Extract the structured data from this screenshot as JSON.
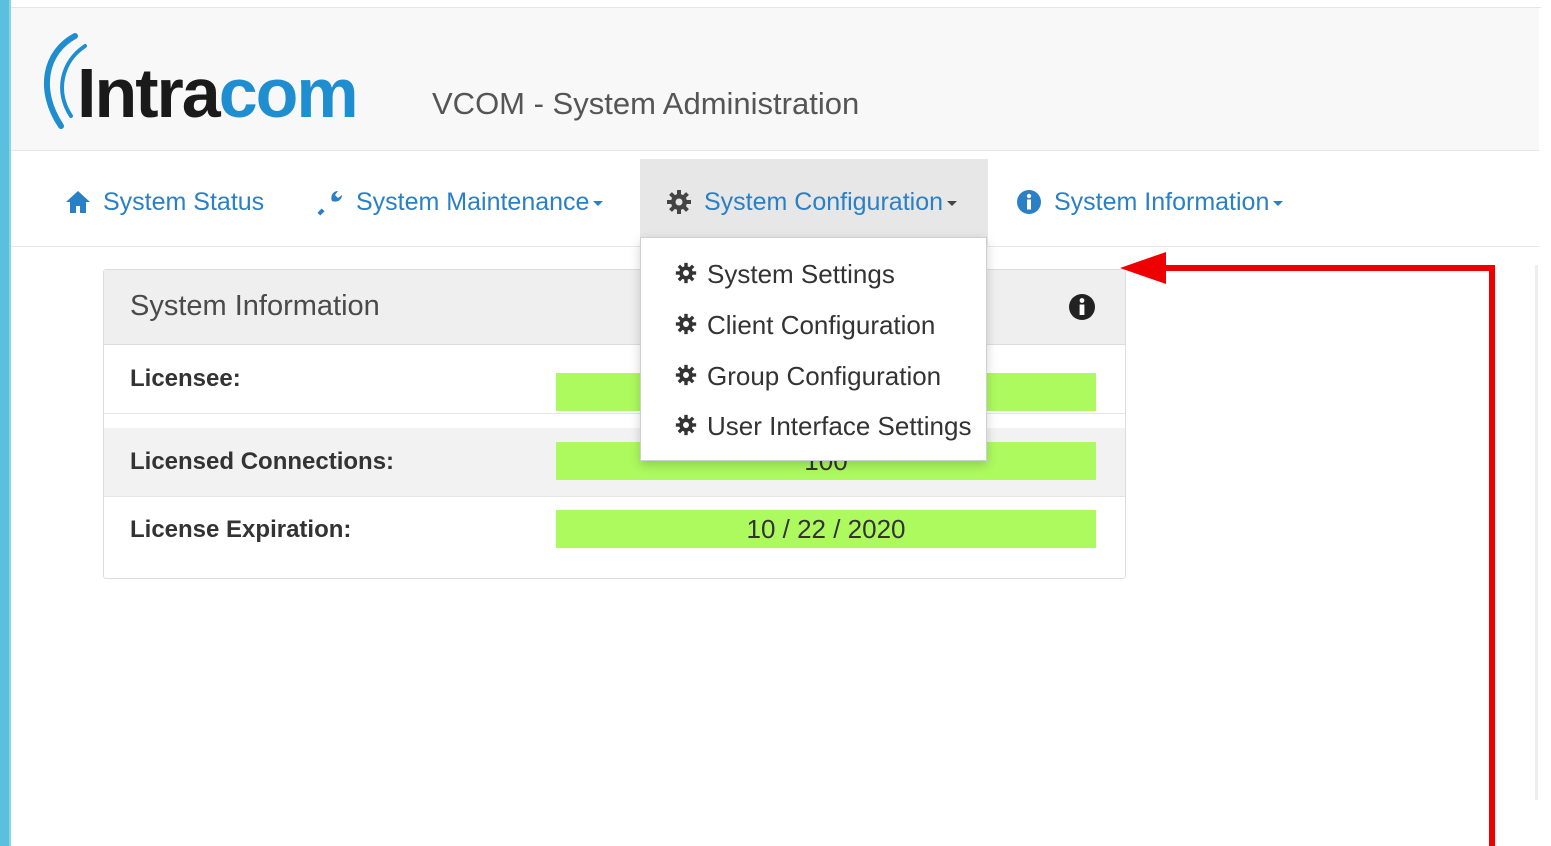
{
  "brand": {
    "logo_text_dark": "Intra",
    "logo_text_blue": "com",
    "app_title": "VCOM - System Administration",
    "accent_color": "#5bc0de",
    "logo_blue": "#1f8ed0"
  },
  "nav": {
    "items": [
      {
        "label": "System Status",
        "icon": "home-icon"
      },
      {
        "label": "System Maintenance",
        "icon": "wrench-icon"
      },
      {
        "label": "System Configuration",
        "icon": "gear-icon"
      },
      {
        "label": "System Information",
        "icon": "info-circle-icon"
      }
    ],
    "link_color": "#2a7fc5"
  },
  "dropdown": {
    "items": [
      {
        "label": "System Settings",
        "icon": "gear-icon"
      },
      {
        "label": "Client Configuration",
        "icon": "gear-icon"
      },
      {
        "label": "Group Configuration",
        "icon": "gear-icon"
      },
      {
        "label": "User Interface Settings",
        "icon": "gear-icon"
      }
    ]
  },
  "panel": {
    "title": "System Information",
    "rows": [
      {
        "label": "Licensee:",
        "value": ""
      },
      {
        "label": "Licensed Connections:",
        "value": "100"
      },
      {
        "label": "License Expiration:",
        "value": "10 / 22 / 2020"
      }
    ],
    "value_bg": "#adfa5f"
  },
  "annotation": {
    "arrow_color": "#ee0000"
  }
}
